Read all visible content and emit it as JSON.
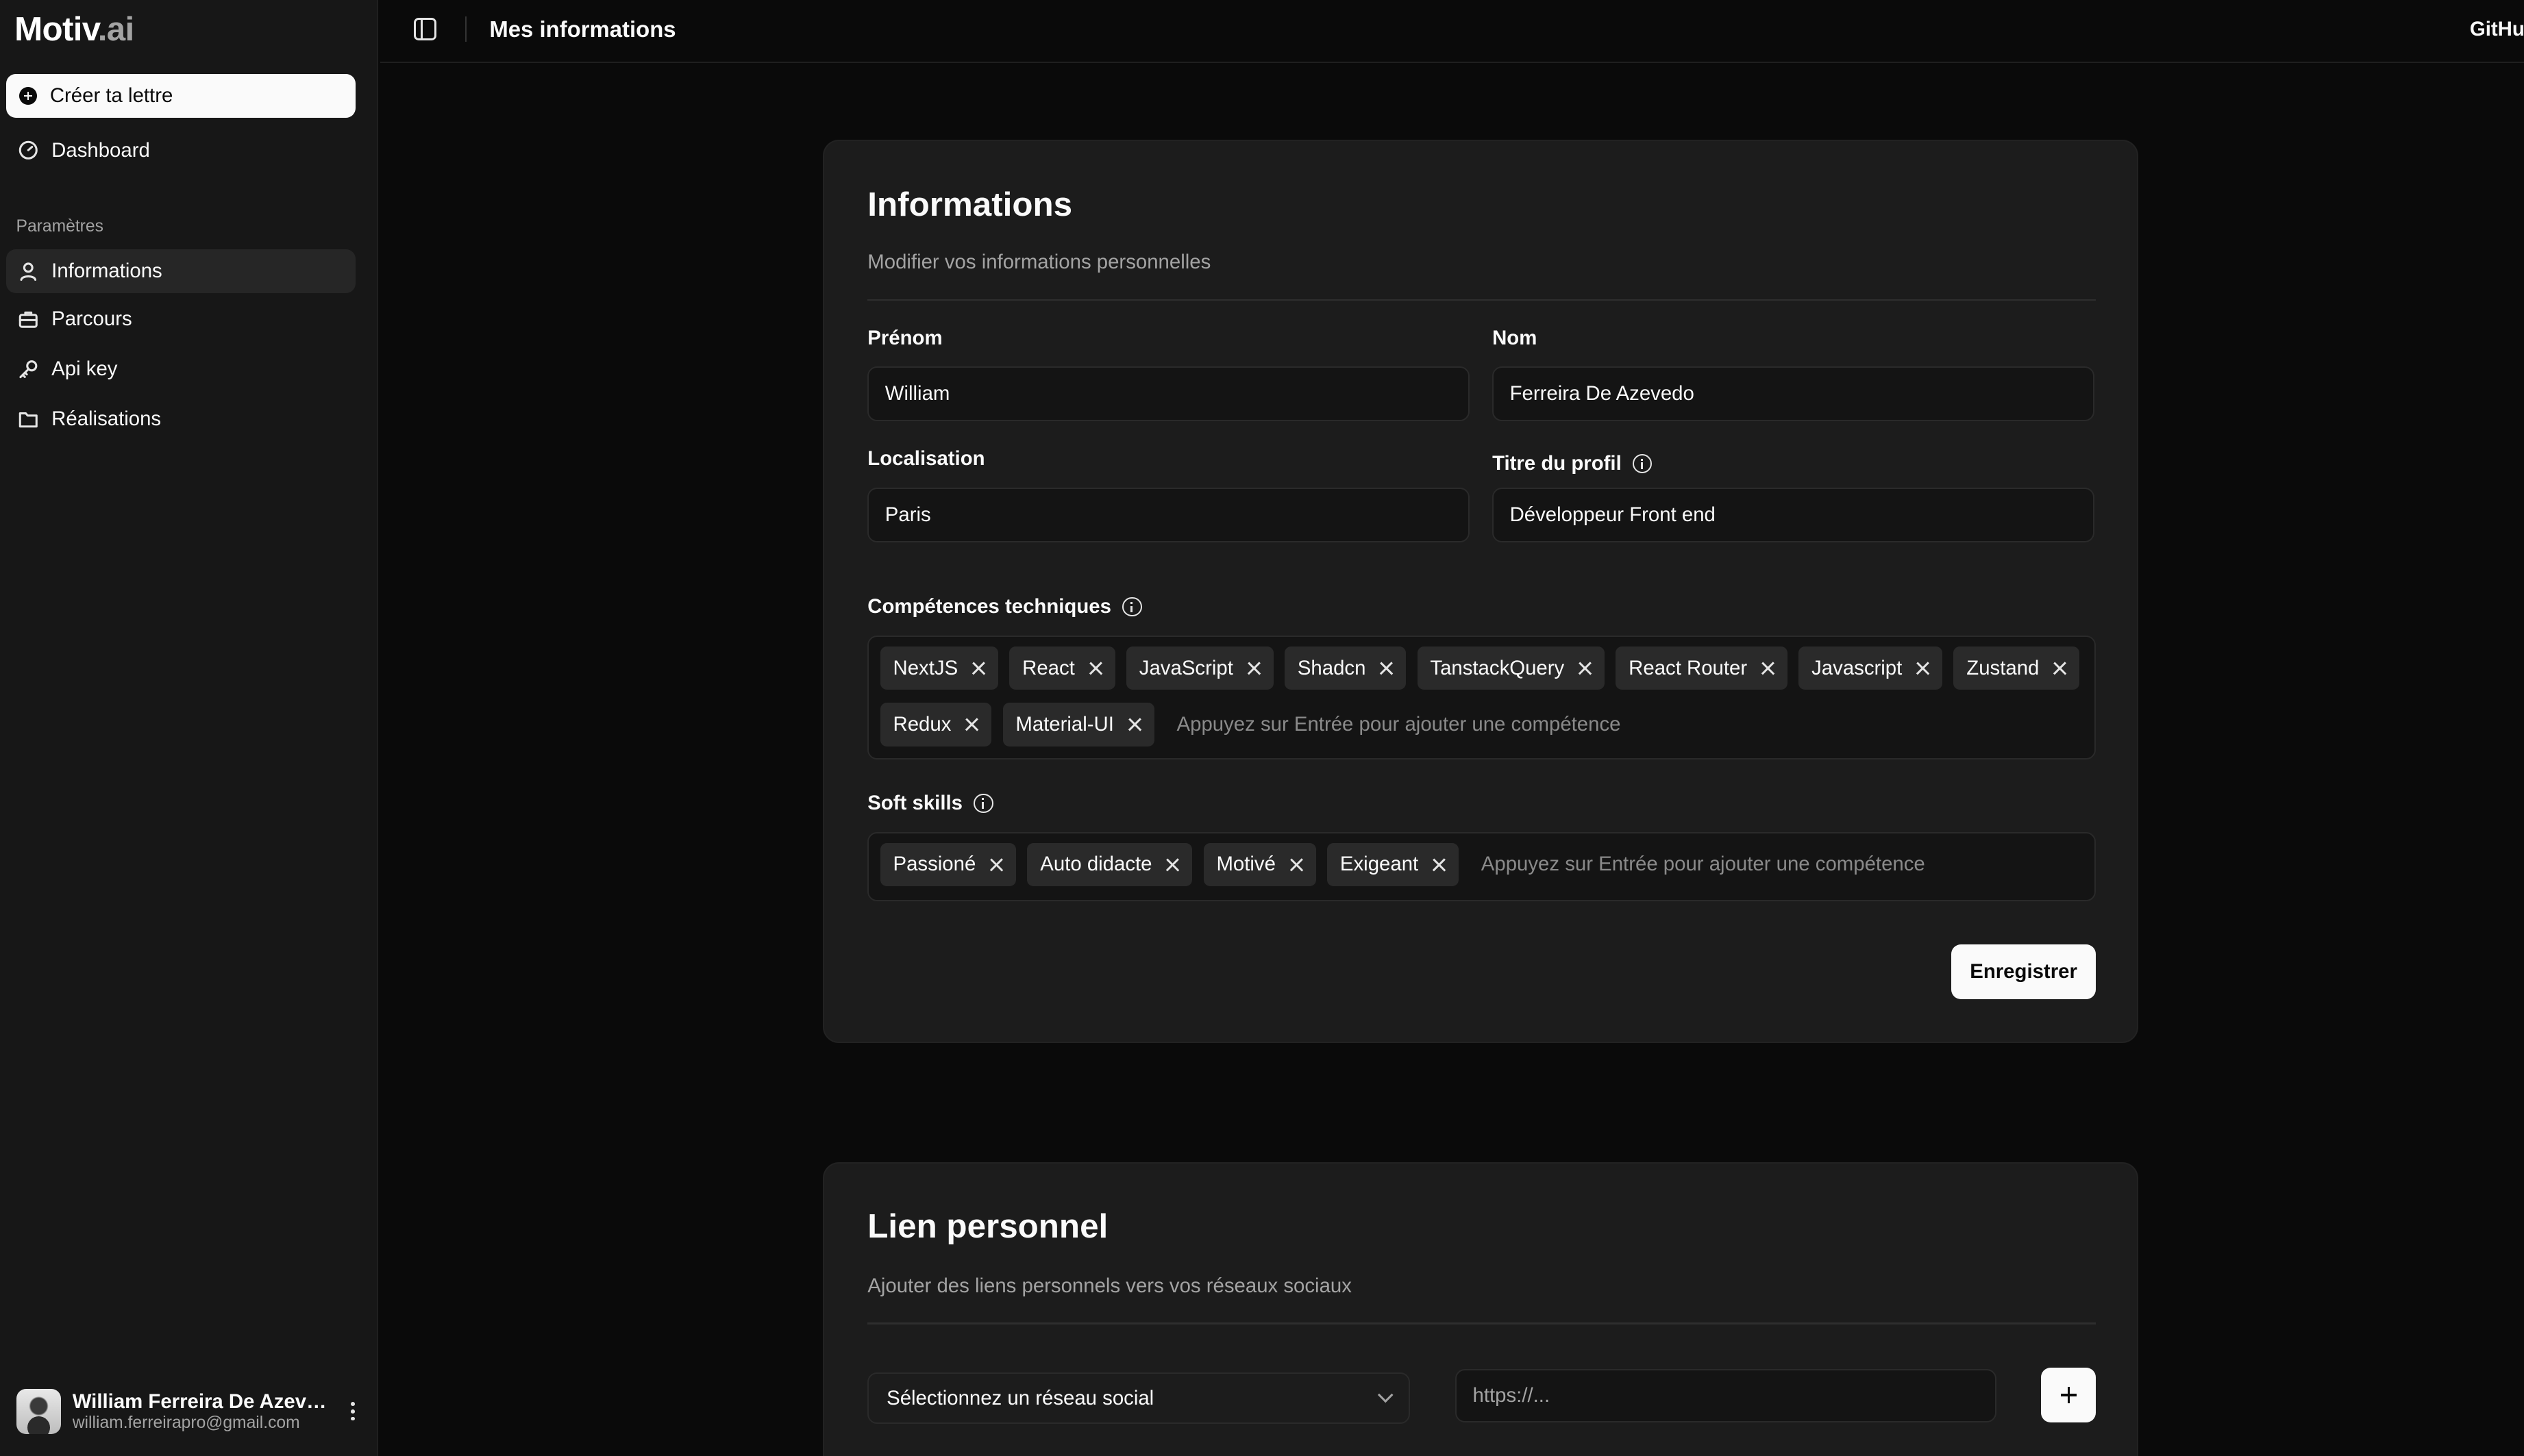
{
  "app": {
    "logo_main": "Motiv",
    "logo_ext": ".ai"
  },
  "sidebar": {
    "create_label": "Créer ta lettre",
    "dashboard_label": "Dashboard",
    "section_label": "Paramètres",
    "items": [
      {
        "label": "Informations",
        "icon": "user-icon",
        "active": true
      },
      {
        "label": "Parcours",
        "icon": "briefcase-icon",
        "active": false
      },
      {
        "label": "Api key",
        "icon": "key-icon",
        "active": false
      },
      {
        "label": "Réalisations",
        "icon": "folder-icon",
        "active": false
      }
    ],
    "user": {
      "name": "William Ferreira De Azevedo",
      "email": "william.ferreirapro@gmail.com"
    }
  },
  "header": {
    "title": "Mes informations",
    "github_label": "GitHub"
  },
  "informations": {
    "title": "Informations",
    "description": "Modifier vos informations personnelles",
    "prenom": {
      "label": "Prénom",
      "value": "William"
    },
    "nom": {
      "label": "Nom",
      "value": "Ferreira De Azevedo"
    },
    "localisation": {
      "label": "Localisation",
      "value": "Paris"
    },
    "titre": {
      "label": "Titre du profil",
      "value": "Développeur Front end"
    },
    "competences": {
      "label": "Compétences techniques",
      "tags": [
        "NextJS",
        "React",
        "JavaScript",
        "Shadcn",
        "TanstackQuery",
        "React Router",
        "Javascript",
        "Zustand",
        "Redux",
        "Material-UI"
      ],
      "placeholder": "Appuyez sur Entrée pour ajouter une compétence"
    },
    "soft_skills": {
      "label": "Soft skills",
      "tags": [
        "Passioné",
        "Auto didacte",
        "Motivé",
        "Exigeant"
      ],
      "placeholder": "Appuyez sur Entrée pour ajouter une compétence"
    },
    "save_label": "Enregistrer"
  },
  "lien": {
    "title": "Lien personnel",
    "description": "Ajouter des liens personnels vers vos réseaux sociaux",
    "select_label": "Sélectionnez un réseau social",
    "url_placeholder": "https://..."
  }
}
